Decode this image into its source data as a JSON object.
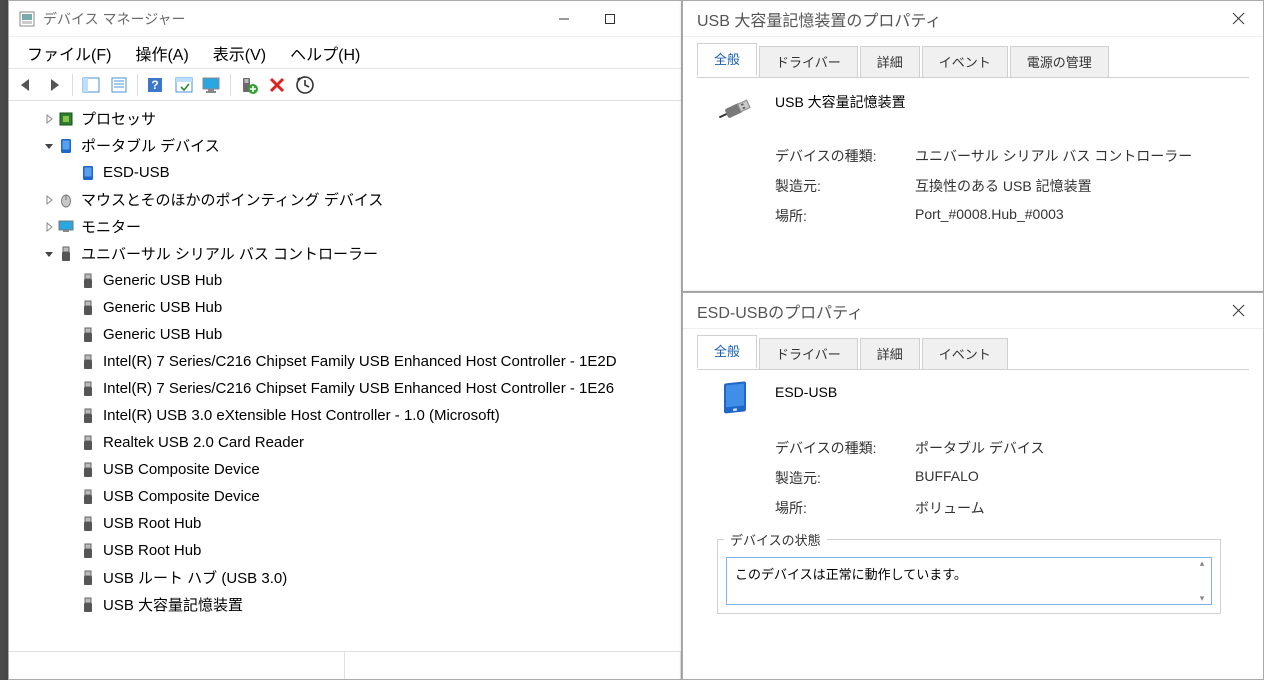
{
  "devmgr": {
    "title": "デバイス マネージャー",
    "menu": {
      "file": "ファイル(F)",
      "action": "操作(A)",
      "view": "表示(V)",
      "help": "ヘルプ(H)"
    },
    "toolbar": [
      {
        "id": "back",
        "kind": "back-arrow"
      },
      {
        "id": "forward",
        "kind": "fwd-arrow"
      },
      {
        "sep": true
      },
      {
        "id": "show-hide",
        "kind": "panel"
      },
      {
        "id": "props",
        "kind": "sheet"
      },
      {
        "sep": true
      },
      {
        "id": "help",
        "kind": "help"
      },
      {
        "id": "scan",
        "kind": "scan"
      },
      {
        "id": "monitor",
        "kind": "monitor"
      },
      {
        "sep": true
      },
      {
        "id": "enable",
        "kind": "enable"
      },
      {
        "id": "disable",
        "kind": "disable"
      },
      {
        "id": "uninstall",
        "kind": "uninstall"
      }
    ],
    "tree": [
      {
        "indent": 1,
        "twisty": ">",
        "icon": "cpu",
        "label": "プロセッサ"
      },
      {
        "indent": 1,
        "twisty": "v",
        "icon": "portable",
        "label": "ポータブル デバイス"
      },
      {
        "indent": 2,
        "twisty": "",
        "icon": "portable",
        "label": "ESD-USB"
      },
      {
        "indent": 1,
        "twisty": ">",
        "icon": "mouse",
        "label": "マウスとそのほかのポインティング デバイス"
      },
      {
        "indent": 1,
        "twisty": ">",
        "icon": "monitor",
        "label": "モニター"
      },
      {
        "indent": 1,
        "twisty": "v",
        "icon": "usb",
        "label": "ユニバーサル シリアル バス コントローラー"
      },
      {
        "indent": 2,
        "twisty": "",
        "icon": "usb",
        "label": "Generic USB Hub"
      },
      {
        "indent": 2,
        "twisty": "",
        "icon": "usb",
        "label": "Generic USB Hub"
      },
      {
        "indent": 2,
        "twisty": "",
        "icon": "usb",
        "label": "Generic USB Hub"
      },
      {
        "indent": 2,
        "twisty": "",
        "icon": "usb",
        "label": "Intel(R) 7 Series/C216 Chipset Family USB Enhanced Host Controller - 1E2D"
      },
      {
        "indent": 2,
        "twisty": "",
        "icon": "usb",
        "label": "Intel(R) 7 Series/C216 Chipset Family USB Enhanced Host Controller - 1E26"
      },
      {
        "indent": 2,
        "twisty": "",
        "icon": "usb",
        "label": "Intel(R) USB 3.0 eXtensible Host Controller - 1.0 (Microsoft)"
      },
      {
        "indent": 2,
        "twisty": "",
        "icon": "usb",
        "label": "Realtek USB 2.0 Card Reader"
      },
      {
        "indent": 2,
        "twisty": "",
        "icon": "usb",
        "label": "USB Composite Device"
      },
      {
        "indent": 2,
        "twisty": "",
        "icon": "usb",
        "label": "USB Composite Device"
      },
      {
        "indent": 2,
        "twisty": "",
        "icon": "usb",
        "label": "USB Root Hub"
      },
      {
        "indent": 2,
        "twisty": "",
        "icon": "usb",
        "label": "USB Root Hub"
      },
      {
        "indent": 2,
        "twisty": "",
        "icon": "usb",
        "label": "USB ルート ハブ (USB 3.0)"
      },
      {
        "indent": 2,
        "twisty": "",
        "icon": "usb",
        "label": "USB 大容量記憶装置"
      }
    ]
  },
  "prop1": {
    "title": "USB 大容量記憶装置のプロパティ",
    "tabs": [
      "全般",
      "ドライバー",
      "詳細",
      "イベント",
      "電源の管理"
    ],
    "active_tab": 0,
    "device_name": "USB 大容量記憶装置",
    "rows": {
      "type_label": "デバイスの種類:",
      "type_value": "ユニバーサル シリアル バス コントローラー",
      "mfg_label": "製造元:",
      "mfg_value": "互換性のある USB 記憶装置",
      "loc_label": "場所:",
      "loc_value": "Port_#0008.Hub_#0003"
    },
    "icon": "usb-plug"
  },
  "prop2": {
    "title": "ESD-USBのプロパティ",
    "tabs": [
      "全般",
      "ドライバー",
      "詳細",
      "イベント"
    ],
    "active_tab": 0,
    "device_name": "ESD-USB",
    "rows": {
      "type_label": "デバイスの種類:",
      "type_value": "ポータブル デバイス",
      "mfg_label": "製造元:",
      "mfg_value": "BUFFALO",
      "loc_label": "場所:",
      "loc_value": "ボリューム"
    },
    "icon": "portable-device",
    "status_legend": "デバイスの状態",
    "status_text": "このデバイスは正常に動作しています。"
  }
}
